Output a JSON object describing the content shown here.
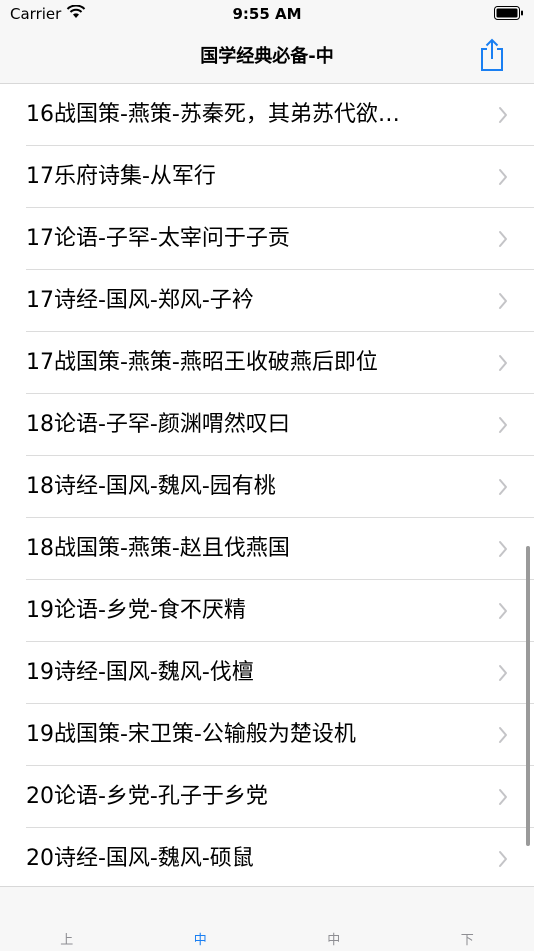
{
  "status_bar": {
    "carrier": "Carrier",
    "time": "9:55 AM"
  },
  "nav": {
    "title": "国学经典必备-中",
    "share_icon": "share-icon"
  },
  "list": {
    "items": [
      "16战国策-燕策-苏秦死，其弟苏代欲…",
      "17乐府诗集-从军行",
      "17论语-子罕-太宰问于子贡",
      "17诗经-国风-郑风-子衿",
      "17战国策-燕策-燕昭王收破燕后即位",
      "18论语-子罕-颜渊喟然叹曰",
      "18诗经-国风-魏风-园有桃",
      "18战国策-燕策-赵且伐燕国",
      "19论语-乡党-食不厌精",
      "19诗经-国风-魏风-伐檀",
      "19战国策-宋卫策-公输般为楚设机",
      "20论语-乡党-孔子于乡党",
      "20诗经-国风-魏风-硕鼠"
    ]
  },
  "tabs": [
    {
      "label": "上",
      "active": false
    },
    {
      "label": "中",
      "active": true
    },
    {
      "label": "中",
      "active": false
    },
    {
      "label": "下",
      "active": false
    }
  ],
  "colors": {
    "accent": "#1a7ff2",
    "inactive": "#8e8e93",
    "bar_bg": "#f7f7f7"
  }
}
